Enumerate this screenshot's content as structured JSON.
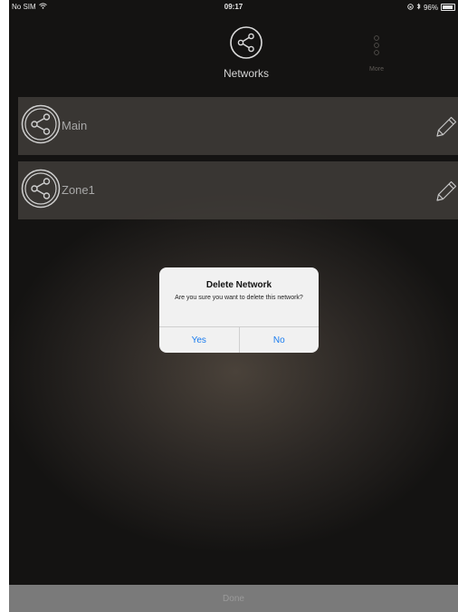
{
  "status_bar": {
    "carrier": "No SIM",
    "time": "09:17",
    "battery": "96%",
    "battery_level": 0.96
  },
  "header": {
    "networks_label": "Networks",
    "more_label": "More"
  },
  "networks": [
    {
      "name": "Main"
    },
    {
      "name": "Zone1"
    }
  ],
  "dialog": {
    "title": "Delete Network",
    "message": "Are you sure you want to delete this network?",
    "yes_label": "Yes",
    "no_label": "No"
  },
  "footer": {
    "done_label": "Done"
  },
  "colors": {
    "accent": "#1a7cf0",
    "row_bg": "#4a4640",
    "done_bar": "#7a7a7a"
  }
}
